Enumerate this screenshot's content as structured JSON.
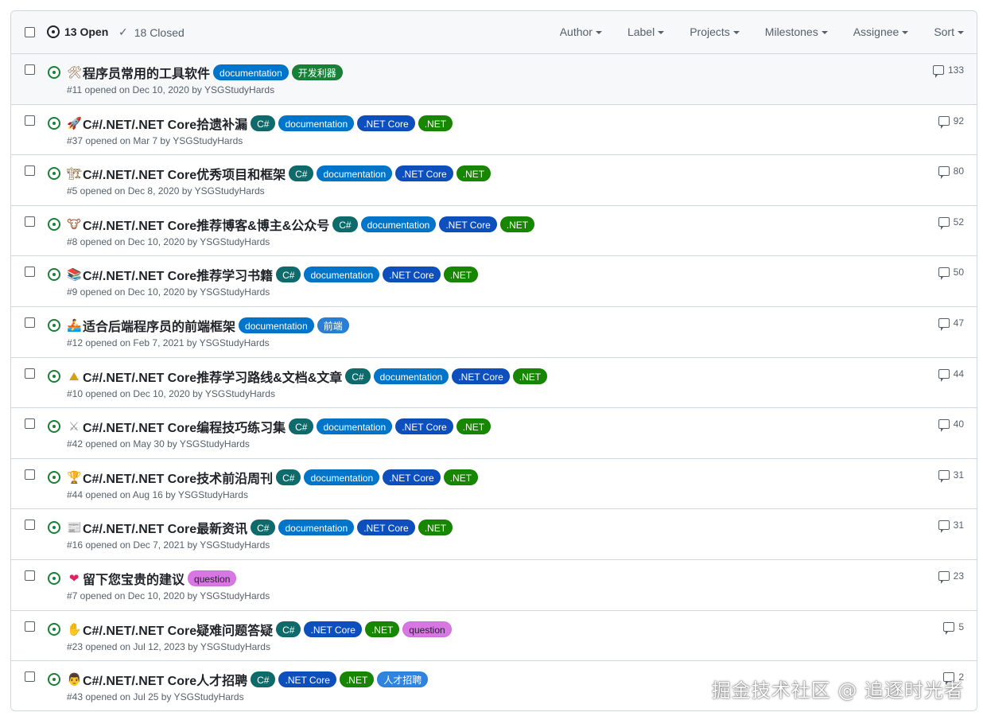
{
  "header": {
    "open_label": "13 Open",
    "closed_label": "18 Closed",
    "filters": [
      "Author",
      "Label",
      "Projects",
      "Milestones",
      "Assignee",
      "Sort"
    ]
  },
  "label_colors": {
    "documentation": "#0075ca",
    "开发利器": "#1a7f37",
    "C#": "#0e6b6b",
    ".NET Core": "#0d4fbd",
    ".NET": "#178600",
    "前端": "#2a7fd4",
    "question": "#d876e3",
    "人才招聘": "#2f84e0"
  },
  "label_text_colors": {
    "question": "#1f2328"
  },
  "issues": [
    {
      "emoji": "🛠",
      "emoji_color": "#8c6a3f",
      "title": "程序员常用的工具软件",
      "labels": [
        "documentation",
        "开发利器"
      ],
      "meta": "#11 opened on Dec 10, 2020 by YSGStudyHards",
      "comments": "133",
      "hover": true
    },
    {
      "emoji": "🚀",
      "emoji_color": "#4a7bd0",
      "title": "C#/.NET/.NET Core拾遗补漏",
      "labels": [
        "C#",
        "documentation",
        ".NET Core",
        ".NET"
      ],
      "meta": "#37 opened on Mar 7 by YSGStudyHards",
      "comments": "92"
    },
    {
      "emoji": "🏗",
      "emoji_color": "#7a5a2a",
      "title": "C#/.NET/.NET Core优秀项目和框架",
      "labels": [
        "C#",
        "documentation",
        ".NET Core",
        ".NET"
      ],
      "meta": "#5 opened on Dec 8, 2020 by YSGStudyHards",
      "comments": "80"
    },
    {
      "emoji": "🐮",
      "emoji_color": "#a0522d",
      "title": "C#/.NET/.NET Core推荐博客&博主&公众号",
      "labels": [
        "C#",
        "documentation",
        ".NET Core",
        ".NET"
      ],
      "meta": "#8 opened on Dec 10, 2020 by YSGStudyHards",
      "comments": "52"
    },
    {
      "emoji": "📚",
      "emoji_color": "#c0392b",
      "title": "C#/.NET/.NET Core推荐学习书籍",
      "labels": [
        "C#",
        "documentation",
        ".NET Core",
        ".NET"
      ],
      "meta": "#9 opened on Dec 10, 2020 by YSGStudyHards",
      "comments": "50"
    },
    {
      "emoji": "🚣",
      "emoji_color": "#2e86c1",
      "title": "适合后端程序员的前端框架",
      "labels": [
        "documentation",
        "前端"
      ],
      "meta": "#12 opened on Feb 7, 2021 by YSGStudyHards",
      "comments": "47"
    },
    {
      "emoji": "⛰",
      "emoji_color": "#d4a017",
      "title": "C#/.NET/.NET Core推荐学习路线&文档&文章",
      "labels": [
        "C#",
        "documentation",
        ".NET Core",
        ".NET"
      ],
      "meta": "#10 opened on Dec 10, 2020 by YSGStudyHards",
      "comments": "44"
    },
    {
      "emoji": "⚔",
      "emoji_color": "#8a8a8a",
      "title": "C#/.NET/.NET Core编程技巧练习集",
      "labels": [
        "C#",
        "documentation",
        ".NET Core",
        ".NET"
      ],
      "meta": "#42 opened on May 30 by YSGStudyHards",
      "comments": "40"
    },
    {
      "emoji": "🏆",
      "emoji_color": "#d4a017",
      "title": "C#/.NET/.NET Core技术前沿周刊",
      "labels": [
        "C#",
        "documentation",
        ".NET Core",
        ".NET"
      ],
      "meta": "#44 opened on Aug 16 by YSGStudyHards",
      "comments": "31"
    },
    {
      "emoji": "📰",
      "emoji_color": "#6b6b6b",
      "title": "C#/.NET/.NET Core最新资讯",
      "labels": [
        "C#",
        "documentation",
        ".NET Core",
        ".NET"
      ],
      "meta": "#16 opened on Dec 7, 2021 by YSGStudyHards",
      "comments": "31"
    },
    {
      "emoji": "❤",
      "emoji_color": "#e0245e",
      "title": "留下您宝贵的建议",
      "labels": [
        "question"
      ],
      "meta": "#7 opened on Dec 10, 2020 by YSGStudyHards",
      "comments": "23"
    },
    {
      "emoji": "✋",
      "emoji_color": "#e8a33d",
      "title": "C#/.NET/.NET Core疑难问题答疑",
      "labels": [
        "C#",
        ".NET Core",
        ".NET",
        "question"
      ],
      "meta": "#23 opened on Jul 12, 2023 by YSGStudyHards",
      "comments": "5"
    },
    {
      "emoji": "👨",
      "emoji_color": "#6b4a2a",
      "title": "C#/.NET/.NET Core人才招聘",
      "labels": [
        "C#",
        ".NET Core",
        ".NET",
        "人才招聘"
      ],
      "meta": "#43 opened on Jul 25 by YSGStudyHards",
      "comments": "2"
    }
  ],
  "watermark": "掘金技术社区 @ 追逐时光者"
}
